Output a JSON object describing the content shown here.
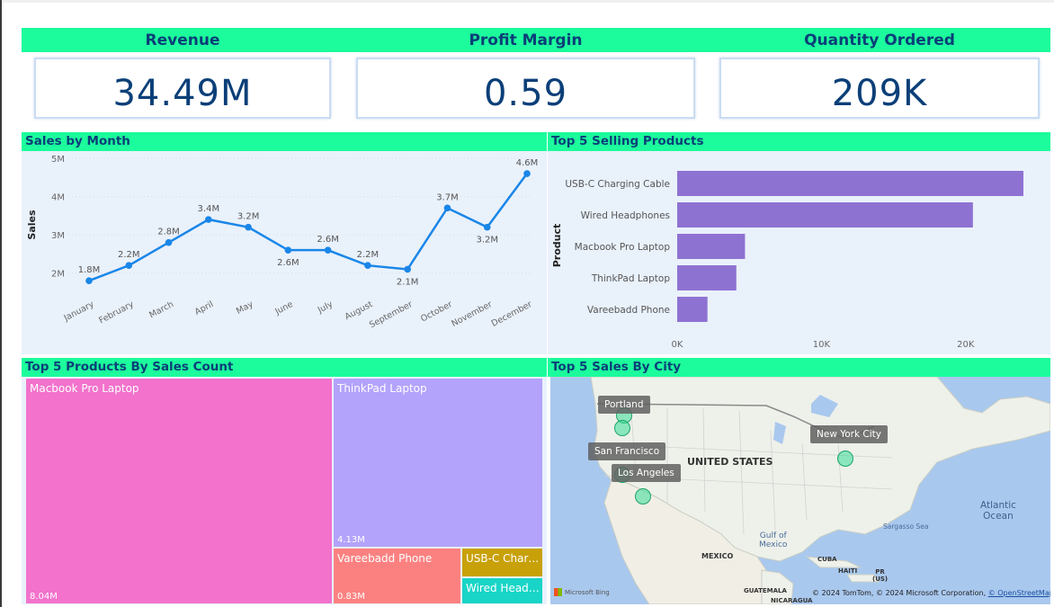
{
  "kpis": [
    {
      "title": "Revenue",
      "value": "34.49M"
    },
    {
      "title": "Profit Margin",
      "value": "0.59"
    },
    {
      "title": "Quantity Ordered",
      "value": "209K"
    }
  ],
  "panels": {
    "sales_by_month": "Sales by Month",
    "top5_selling": "Top 5 Selling Products",
    "top5_by_count": "Top 5 Products By Sales Count",
    "top5_city": "Top 5 Sales By City"
  },
  "colors": {
    "accent_band": "#1cfc9c",
    "title_text": "#0b3f78",
    "line": "#1a86e8",
    "bar": "#8e72d2"
  },
  "chart_data": [
    {
      "type": "line",
      "title": "Sales by Month",
      "ylabel": "Sales",
      "xlabel": "",
      "categories": [
        "January",
        "February",
        "March",
        "April",
        "May",
        "June",
        "July",
        "August",
        "September",
        "October",
        "November",
        "December"
      ],
      "values": [
        1.8,
        2.2,
        2.8,
        3.4,
        3.2,
        2.6,
        2.6,
        2.2,
        2.1,
        3.7,
        3.2,
        4.6
      ],
      "data_labels": [
        "1.8M",
        "2.2M",
        "2.8M",
        "3.4M",
        "3.2M",
        "2.6M",
        "2.6M",
        "2.2M",
        "2.1M",
        "3.7M",
        "3.2M",
        "4.6M"
      ],
      "yticks": [
        "2M",
        "3M",
        "4M",
        "5M"
      ],
      "ylim": [
        1.5,
        5
      ],
      "grid": true
    },
    {
      "type": "bar",
      "orientation": "horizontal",
      "title": "Top 5 Selling Products",
      "ylabel": "Product",
      "xlabel": "",
      "categories": [
        "USB-C Charging Cable",
        "Wired Headphones",
        "Macbook Pro Laptop",
        "ThinkPad Laptop",
        "Vareebadd Phone"
      ],
      "values": [
        24000,
        20500,
        4700,
        4100,
        2100
      ],
      "xticks": [
        "0K",
        "10K",
        "20K"
      ],
      "xlim": [
        0,
        24500
      ]
    },
    {
      "type": "treemap",
      "title": "Top 5 Products By Sales Count",
      "items": [
        {
          "name": "Macbook Pro Laptop",
          "label": "Macbook Pro Laptop",
          "value_label": "8.04M",
          "value": 8.04,
          "color": "#f272cc"
        },
        {
          "name": "ThinkPad Laptop",
          "label": "ThinkPad Laptop",
          "value_label": "4.13M",
          "value": 4.13,
          "color": "#b3a3fb"
        },
        {
          "name": "Vareebadd Phone",
          "label": "Vareebadd Phone",
          "value_label": "0.83M",
          "value": 0.83,
          "color": "#fb8181"
        },
        {
          "name": "USB-C Charging Cable",
          "label": "USB-C Chargi...",
          "color": "#c8a109"
        },
        {
          "name": "Wired Headphones",
          "label": "Wired Headp...",
          "color": "#18d5c7"
        }
      ]
    }
  ],
  "map": {
    "cities": [
      "Portland",
      "San Francisco",
      "Los Angeles",
      "New York City"
    ],
    "labels": {
      "country": "UNITED STATES",
      "mexico": "MEXICO",
      "gulf1": "Gulf of",
      "gulf2": "Mexico",
      "atlantic1": "Atlantic",
      "atlantic2": "Ocean",
      "sargasso": "Sargasso Sea",
      "cuba": "CUBA",
      "haiti": "HAITI",
      "pr1": "PR",
      "pr2": "(US)",
      "guatemala": "GUATEMALA",
      "nicaragua": "NICARAGUA",
      "bing": "Microsoft Bing",
      "attribution": "© 2024 TomTom, © 2024 Microsoft Corporation,",
      "osm": "© OpenStreetMap"
    }
  }
}
